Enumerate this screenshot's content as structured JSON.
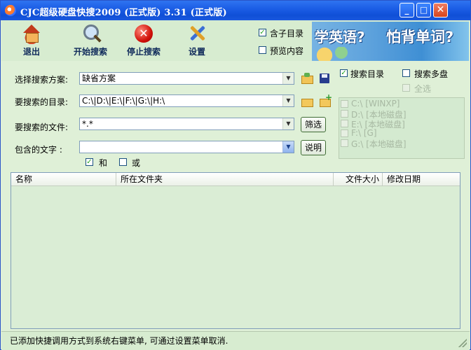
{
  "window": {
    "title": "CJC超级硬盘快搜2009 (正式版) 3.31 (正式版)",
    "controls": {
      "minimize": "_",
      "maximize": "□",
      "close": "✕"
    }
  },
  "toolbar": {
    "exit_label": "退出",
    "start_label": "开始搜索",
    "stop_label": "停止搜索",
    "settings_label": "设置",
    "include_subdirs": {
      "label": "含子目录",
      "checked": true
    },
    "preview_content": {
      "label": "预览内容",
      "checked": false
    }
  },
  "banner": {
    "text1": "学英语?",
    "text2": "怕背单词?"
  },
  "form": {
    "scheme": {
      "label": "选择搜索方案:",
      "value": "缺省方案"
    },
    "directories": {
      "label": "要搜索的目录:",
      "value": "C:\\|D:\\|E:\\|F:\\|G:\\|H:\\"
    },
    "files": {
      "label": "要搜索的文件:",
      "value": "*.*",
      "filter_button": "筛选"
    },
    "text": {
      "label": "包含的文字 :",
      "value": "",
      "help_button": "说明"
    },
    "and": {
      "label": "和",
      "checked": true
    },
    "or": {
      "label": "或",
      "checked": false
    }
  },
  "options": {
    "search_dirs": {
      "label": "搜索目录",
      "checked": true
    },
    "search_multi": {
      "label": "搜索多盘",
      "checked": false
    },
    "select_all": {
      "label": "全选",
      "checked": false
    }
  },
  "drives": [
    {
      "label": "C:\\ [WINXP]"
    },
    {
      "label": "D:\\ [本地磁盘]"
    },
    {
      "label": "E:\\ [本地磁盘]"
    },
    {
      "label": "F:\\ [G]"
    },
    {
      "label": "G:\\ [本地磁盘]"
    }
  ],
  "results": {
    "columns": [
      "名称",
      "所在文件夹",
      "文件大小",
      "修改日期"
    ]
  },
  "status": {
    "text": "已添加快捷调用方式到系统右键菜单, 可通过设置菜单取消."
  }
}
